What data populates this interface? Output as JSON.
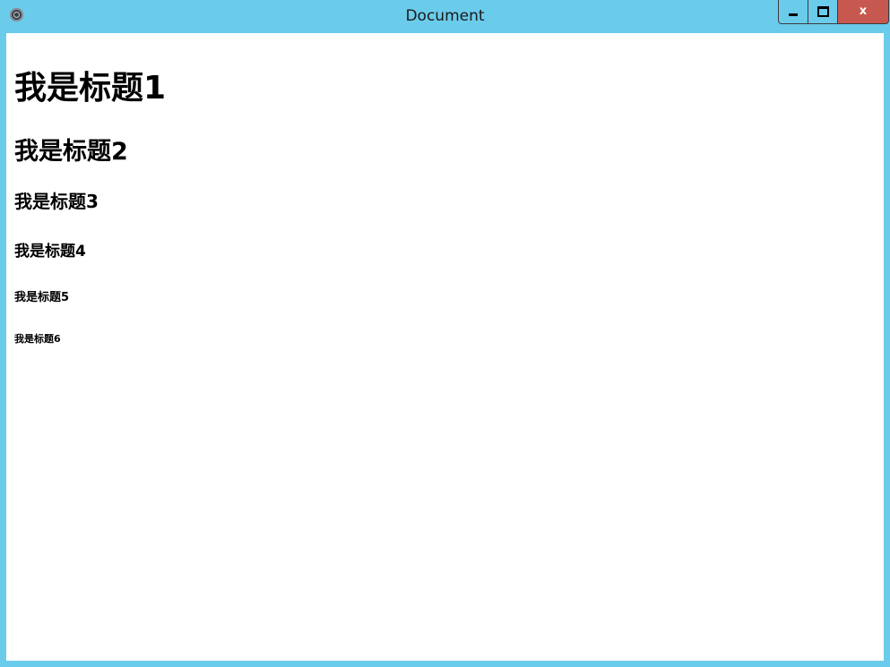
{
  "window": {
    "title": "Document",
    "controls": {
      "minimize_icon": "minimize-icon",
      "maximize_icon": "maximize-icon",
      "close_label": "x"
    },
    "colors": {
      "frame": "#6bcbeb",
      "close": "#c7584f",
      "content_bg": "#ffffff"
    }
  },
  "document": {
    "headings": {
      "h1": "我是标题1",
      "h2": "我是标题2",
      "h3": "我是标题3",
      "h4": "我是标题4",
      "h5": "我是标题5",
      "h6": "我是标题6"
    }
  }
}
